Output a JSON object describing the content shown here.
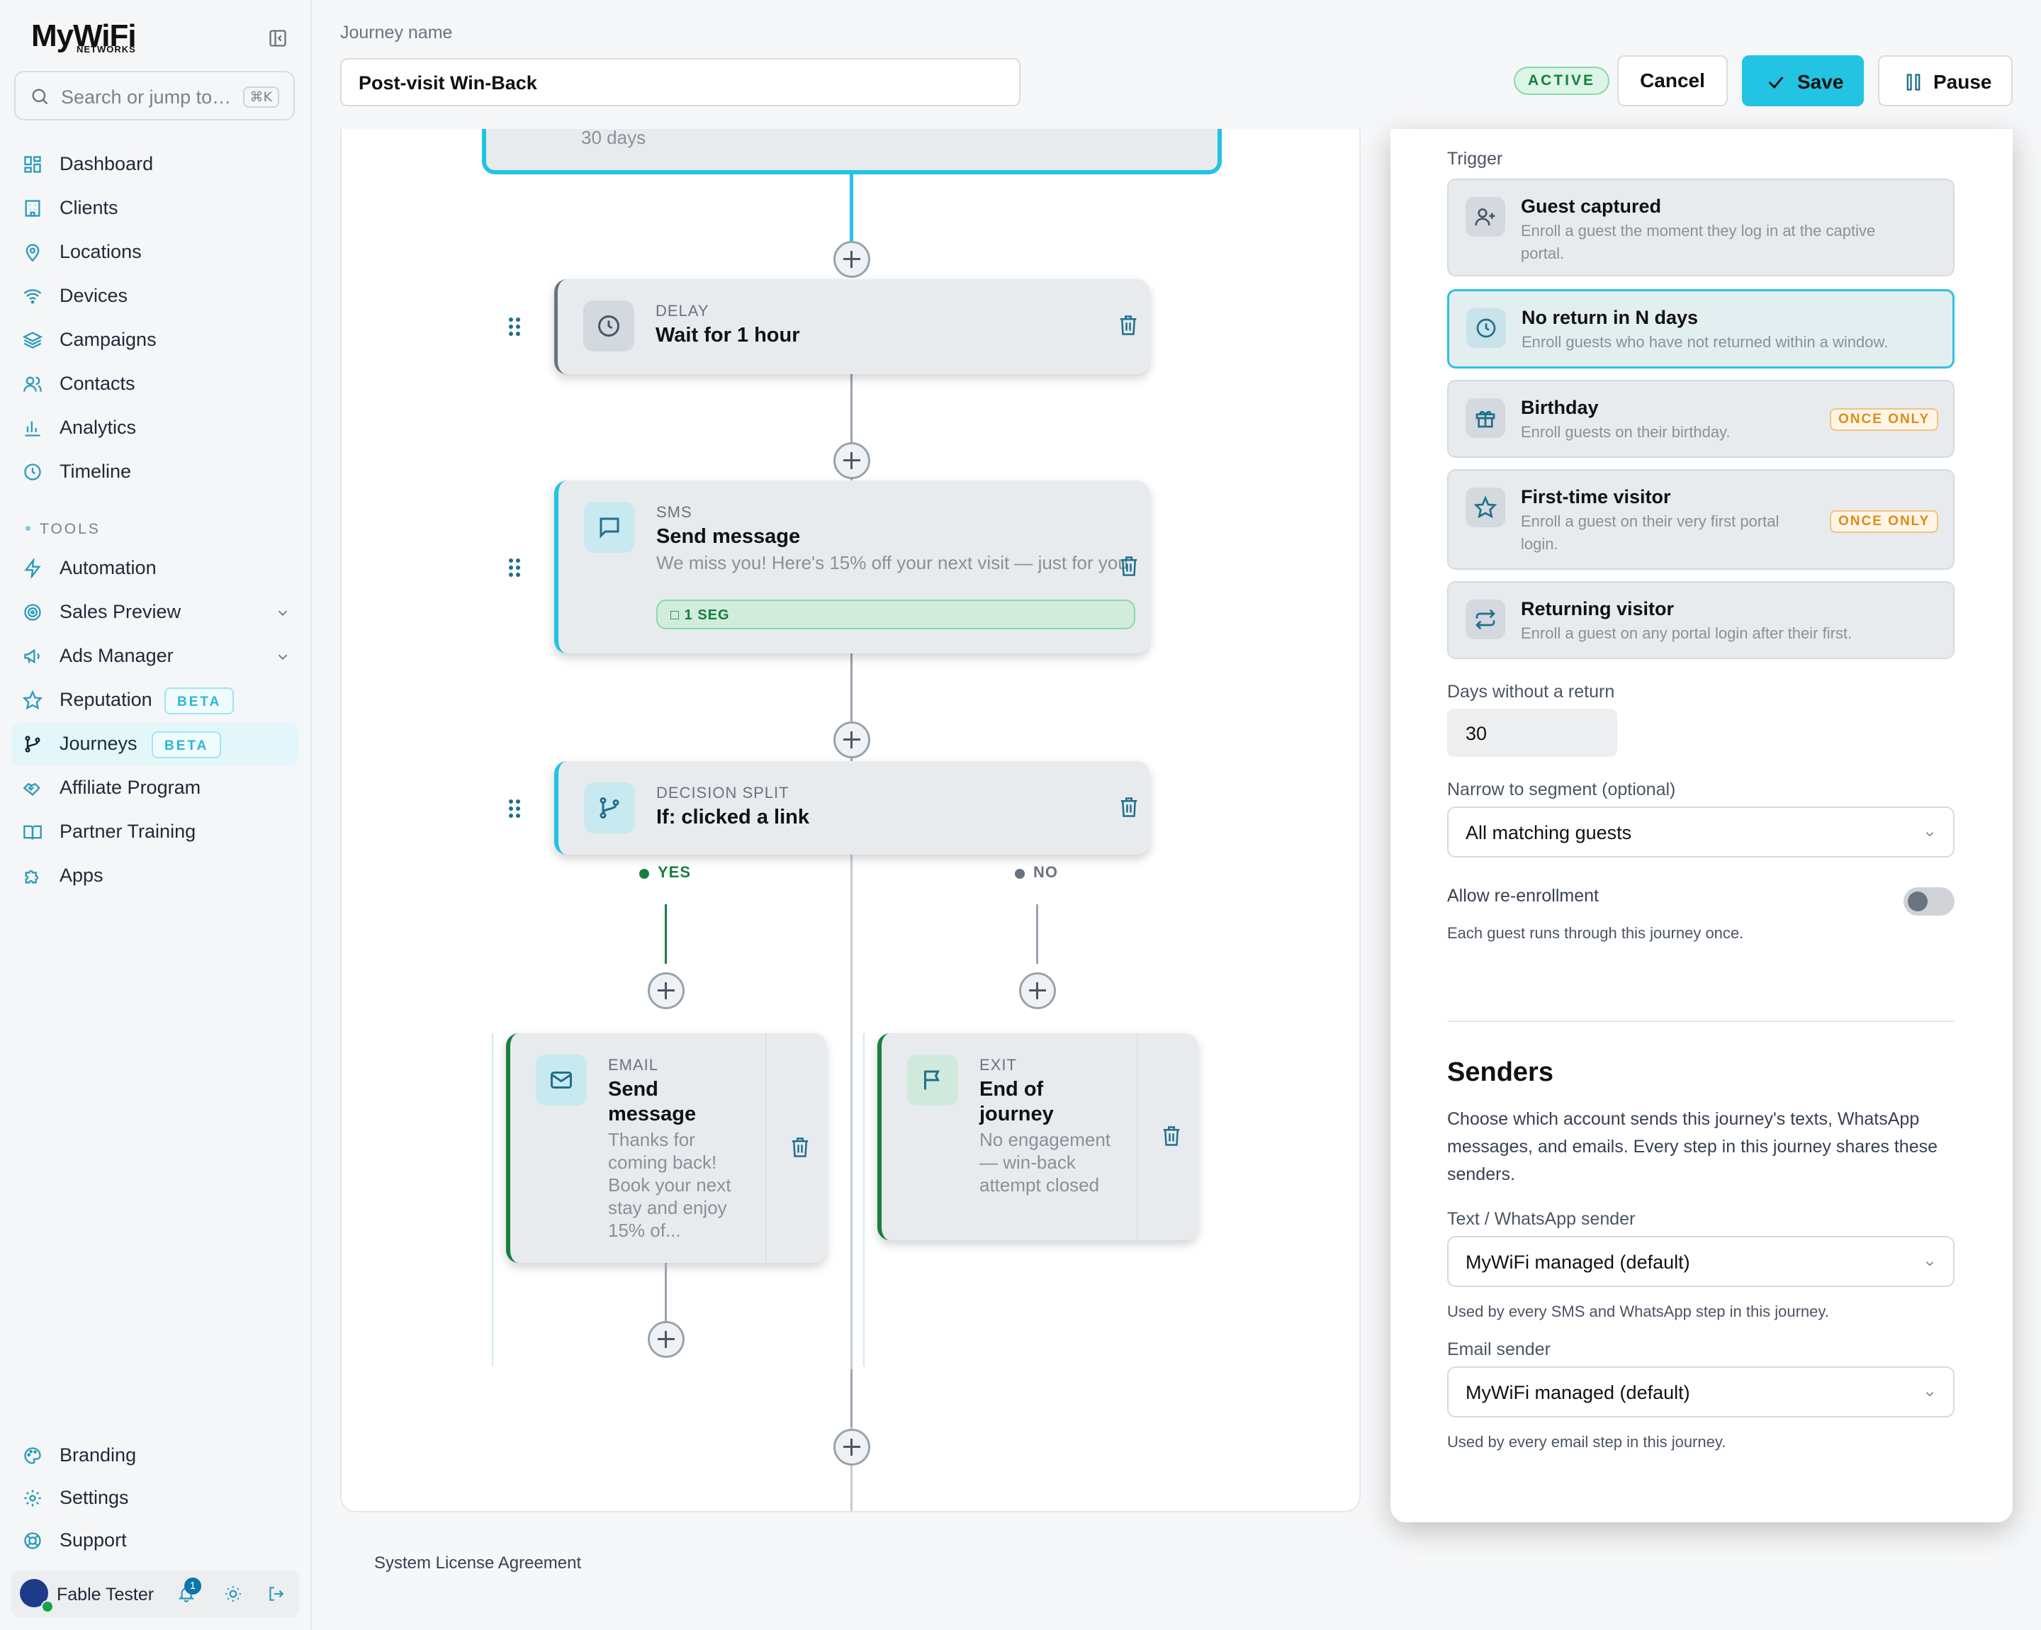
{
  "app": {
    "logo": "MyWiFi",
    "logo_sub": "NETWORKS"
  },
  "search": {
    "placeholder": "Search or jump to…",
    "shortcut": "⌘K"
  },
  "sidebar": {
    "main_items": [
      {
        "label": "Dashboard",
        "icon": "grid-icon"
      },
      {
        "label": "Clients",
        "icon": "building-icon"
      },
      {
        "label": "Locations",
        "icon": "map-pin-icon"
      },
      {
        "label": "Devices",
        "icon": "wifi-icon"
      },
      {
        "label": "Campaigns",
        "icon": "layers-icon"
      },
      {
        "label": "Contacts",
        "icon": "users-icon"
      },
      {
        "label": "Analytics",
        "icon": "bar-chart-icon"
      },
      {
        "label": "Timeline",
        "icon": "clock-icon"
      }
    ],
    "tools_label": "TOOLS",
    "tool_items": [
      {
        "label": "Automation",
        "icon": "bolt-icon"
      },
      {
        "label": "Sales Preview",
        "icon": "target-icon"
      },
      {
        "label": "Ads Manager",
        "icon": "megaphone-icon"
      },
      {
        "label": "Reputation",
        "icon": "star-icon",
        "badge": "BETA"
      },
      {
        "label": "Journeys",
        "icon": "branch-icon",
        "badge": "BETA",
        "active": true
      },
      {
        "label": "Affiliate Program",
        "icon": "handshake-icon"
      },
      {
        "label": "Partner Training",
        "icon": "book-icon"
      },
      {
        "label": "Apps",
        "icon": "puzzle-icon"
      }
    ],
    "bottom_items": [
      {
        "label": "Branding",
        "icon": "palette-icon"
      },
      {
        "label": "Settings",
        "icon": "gear-icon"
      },
      {
        "label": "Support",
        "icon": "lifebuoy-icon"
      }
    ],
    "user": {
      "name": "Fable Tester",
      "notifications": "1"
    }
  },
  "header": {
    "journey_name_label": "Journey name",
    "journey_name": "Post-visit Win-Back",
    "status": "ACTIVE",
    "cancel": "Cancel",
    "save": "Save",
    "pause": "Pause"
  },
  "canvas": {
    "top_node_text": "30 days",
    "delay": {
      "kind": "DELAY",
      "title": "Wait for 1 hour"
    },
    "sms": {
      "kind": "SMS",
      "title": "Send message",
      "body": "We miss you! Here's 15% off your next visit — just for you.",
      "segments": "1 SEG"
    },
    "split": {
      "kind": "DECISION SPLIT",
      "title": "If: clicked a link",
      "yes": "YES",
      "no": "NO"
    },
    "email": {
      "kind": "EMAIL",
      "title": "Send message",
      "body": "Thanks for coming back! Book your next stay and enjoy 15% of..."
    },
    "exit": {
      "kind": "EXIT",
      "title": "End of journey",
      "body": "No engagement — win-back attempt closed"
    }
  },
  "footer": {
    "license": "System License Agreement"
  },
  "panel": {
    "trigger_label": "Trigger",
    "triggers": [
      {
        "title": "Guest captured",
        "desc": "Enroll a guest the moment they log in at the captive portal.",
        "icon": "user-plus-icon"
      },
      {
        "title": "No return in N days",
        "desc": "Enroll guests who have not returned within a window.",
        "icon": "clock-icon",
        "selected": true
      },
      {
        "title": "Birthday",
        "desc": "Enroll guests on their birthday.",
        "icon": "gift-icon",
        "badge": "ONCE ONLY"
      },
      {
        "title": "First-time visitor",
        "desc": "Enroll a guest on their very first portal login.",
        "icon": "star-icon",
        "badge": "ONCE ONLY"
      },
      {
        "title": "Returning visitor",
        "desc": "Enroll a guest on any portal login after their first.",
        "icon": "repeat-icon"
      }
    ],
    "days_label": "Days without a return",
    "days_value": "30",
    "segment_label": "Narrow to segment (optional)",
    "segment_value": "All matching guests",
    "reenroll_label": "Allow re-enrollment",
    "reenroll_enabled": false,
    "reenroll_help": "Each guest runs through this journey once.",
    "senders_title": "Senders",
    "senders_desc": "Choose which account sends this journey's texts, WhatsApp messages, and emails. Every step in this journey shares these senders.",
    "text_sender_label": "Text / WhatsApp sender",
    "text_sender_value": "MyWiFi managed (default)",
    "text_sender_help": "Used by every SMS and WhatsApp step in this journey.",
    "email_sender_label": "Email sender",
    "email_sender_value": "MyWiFi managed (default)",
    "email_sender_help": "Used by every email step in this journey."
  },
  "colors": {
    "accent": "#22c3e3",
    "active_green": "#15803d",
    "once_only": "#e08a1a"
  }
}
